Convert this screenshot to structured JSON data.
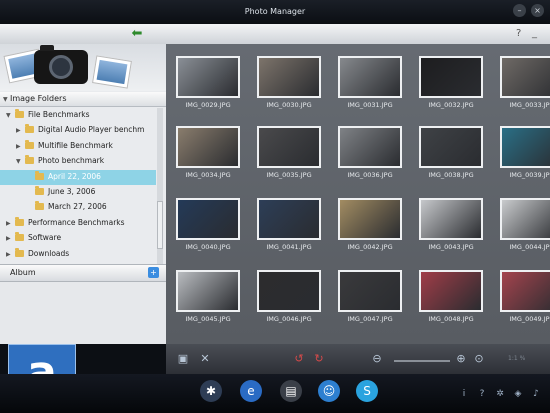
{
  "window": {
    "title": "Photo Manager"
  },
  "sidebar": {
    "section_title": "Image Folders",
    "tree": [
      {
        "label": "File Benchmarks",
        "level": 1,
        "expanded": true
      },
      {
        "label": "Digital Audio Player benchm",
        "level": 2,
        "expanded": false
      },
      {
        "label": "Multifile Benchmark",
        "level": 2,
        "expanded": false
      },
      {
        "label": "Photo benchmark",
        "level": 2,
        "expanded": true
      },
      {
        "label": "April 22, 2006",
        "level": 3,
        "selected": true
      },
      {
        "label": "June 3, 2006",
        "level": 3
      },
      {
        "label": "March 27, 2006",
        "level": 3
      },
      {
        "label": "Performance Benchmarks",
        "level": 1,
        "expanded": false
      },
      {
        "label": "Software",
        "level": 1,
        "expanded": false
      },
      {
        "label": "Downloads",
        "level": 1,
        "expanded": false
      }
    ],
    "album_label": "Album"
  },
  "thumbnails": [
    {
      "filename": "IMG_0029.JPG",
      "color": "#8a8f96"
    },
    {
      "filename": "IMG_0030.JPG",
      "color": "#7d746b"
    },
    {
      "filename": "IMG_0031.JPG",
      "color": "#86898d"
    },
    {
      "filename": "IMG_0032.JPG",
      "color": "#1d1d1f"
    },
    {
      "filename": "IMG_0033.JPG",
      "color": "#6f6a66"
    },
    {
      "filename": "IMG_0034.JPG",
      "color": "#8a7d6d"
    },
    {
      "filename": "IMG_0035.JPG",
      "color": "#4a4a4c"
    },
    {
      "filename": "IMG_0036.JPG",
      "color": "#7f8286"
    },
    {
      "filename": "IMG_0038.JPG",
      "color": "#3f4246"
    },
    {
      "filename": "IMG_0039.JPG",
      "color": "#2a6f86"
    },
    {
      "filename": "IMG_0040.JPG",
      "color": "#243a58"
    },
    {
      "filename": "IMG_0041.JPG",
      "color": "#2d3e57"
    },
    {
      "filename": "IMG_0042.JPG",
      "color": "#a28c62"
    },
    {
      "filename": "IMG_0043.JPG",
      "color": "#c6c8cb"
    },
    {
      "filename": "IMG_0044.JPG",
      "color": "#c9cbcd"
    },
    {
      "filename": "IMG_0045.JPG",
      "color": "#b9bcc0"
    },
    {
      "filename": "IMG_0046.JPG",
      "color": "#2c2c2e"
    },
    {
      "filename": "IMG_0047.JPG",
      "color": "#3a3a3c"
    },
    {
      "filename": "IMG_0048.JPG",
      "color": "#a03d48"
    },
    {
      "filename": "IMG_0049.JPG",
      "color": "#a4444e"
    }
  ],
  "bottombar": {
    "zoom_text": "1:1 %"
  },
  "logo": {
    "letter": "a"
  },
  "colors": {
    "selection": "#8ed3e6",
    "folder": "#e3b94f",
    "logo": "#2f6fbf"
  },
  "icons": {
    "toolbar": [
      "back-arrow-icon",
      "question-icon",
      "minimize-icon"
    ],
    "taskbar": [
      "tools-icon",
      "internet-explorer-icon",
      "photo-icon",
      "chat-icon",
      "skype-icon"
    ],
    "tray": [
      "info-icon",
      "help-icon",
      "settings-icon",
      "network-icon",
      "volume-icon"
    ]
  }
}
